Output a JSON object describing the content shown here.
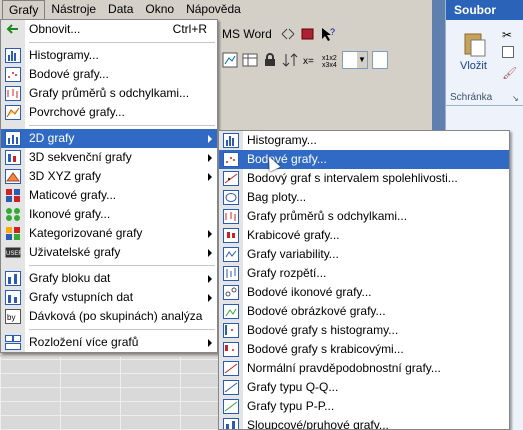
{
  "menubar": {
    "items": [
      "Grafy",
      "Nástroje",
      "Data",
      "Okno",
      "Nápověda"
    ]
  },
  "toolbar": {
    "ms_word_label": "MS Word"
  },
  "ribbon": {
    "tab": "Soubor",
    "paste_label": "Vložit",
    "group_label": "Schránka"
  },
  "menu_grafy": {
    "items": [
      {
        "label": "Obnovit...",
        "shortcut": "Ctrl+R"
      },
      {
        "label": "Histogramy..."
      },
      {
        "label": "Bodové grafy..."
      },
      {
        "label": "Grafy průměrů s odchylkami..."
      },
      {
        "label": "Povrchové grafy..."
      },
      {
        "label": "2D grafy"
      },
      {
        "label": "3D sekvenční grafy"
      },
      {
        "label": "3D XYZ grafy"
      },
      {
        "label": "Maticové grafy..."
      },
      {
        "label": "Ikonové grafy..."
      },
      {
        "label": "Kategorizované grafy"
      },
      {
        "label": "Uživatelské grafy"
      },
      {
        "label": "Grafy bloku dat"
      },
      {
        "label": "Grafy vstupních dat"
      },
      {
        "label": "Dávková (po skupinách) analýza"
      },
      {
        "label": "Rozložení více grafů"
      }
    ]
  },
  "menu_2d": {
    "items": [
      "Histogramy...",
      "Bodové grafy...",
      "Bodový graf s intervalem spolehlivosti...",
      "Bag ploty...",
      "Grafy průměrů s odchylkami...",
      "Krabicové grafy...",
      "Grafy variability...",
      "Grafy rozpětí...",
      "Bodové ikonové grafy...",
      "Bodové obrázkové grafy...",
      "Bodové grafy s histogramy...",
      "Bodové grafy s krabicovými...",
      "Normální pravděpodobnostní grafy...",
      "Grafy typu Q-Q...",
      "Grafy typu P-P...",
      "Sloupcové/pruhové grafy..."
    ]
  }
}
